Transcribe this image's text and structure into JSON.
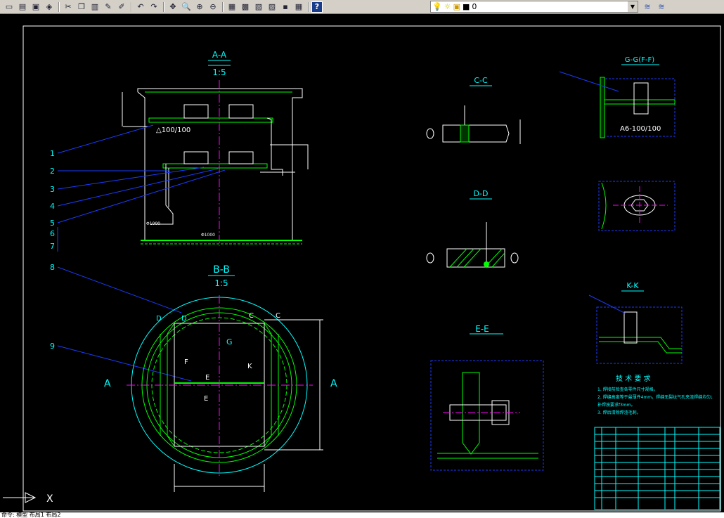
{
  "toolbar": {
    "buttons": [
      {
        "name": "new-icon",
        "glyph": "▭"
      },
      {
        "name": "open-icon",
        "glyph": "▤"
      },
      {
        "name": "save-icon",
        "glyph": "▣"
      },
      {
        "name": "plot-icon",
        "glyph": "◈"
      },
      {
        "sep": true
      },
      {
        "name": "cut-icon",
        "glyph": "✂"
      },
      {
        "name": "copy-icon",
        "glyph": "❐"
      },
      {
        "name": "paste-icon",
        "glyph": "▥"
      },
      {
        "name": "matchprop-icon",
        "glyph": "✎"
      },
      {
        "name": "brush-icon",
        "glyph": "✐"
      },
      {
        "sep": true
      },
      {
        "name": "undo-icon",
        "glyph": "↶"
      },
      {
        "name": "redo-icon",
        "glyph": "↷"
      },
      {
        "sep": true
      },
      {
        "name": "pan-icon",
        "glyph": "✥"
      },
      {
        "name": "zoom-realtime-icon",
        "glyph": "🔍"
      },
      {
        "name": "zoom-window-icon",
        "glyph": "⊕"
      },
      {
        "name": "zoom-previous-icon",
        "glyph": "⊖"
      },
      {
        "sep": true
      },
      {
        "name": "properties-icon",
        "glyph": "▦"
      },
      {
        "name": "designcenter-icon",
        "glyph": "▩"
      },
      {
        "name": "toolpalette-icon",
        "glyph": "▧"
      },
      {
        "name": "sheetset-icon",
        "glyph": "▨"
      },
      {
        "name": "markup-icon",
        "glyph": "▪"
      },
      {
        "name": "calculator-icon",
        "glyph": "▦"
      },
      {
        "sep": true
      }
    ],
    "help_label": "?",
    "layer_name": "0",
    "layer_icons": [
      "bulb-icon",
      "sun-icon",
      "lock-icon",
      "color-square-icon"
    ],
    "layer_state_glyphs": [
      "💡",
      "☼",
      "🔓",
      "■"
    ],
    "right_tools": [
      "≋",
      "≋"
    ]
  },
  "colors": {
    "background": "#000000",
    "white": "#ffffff",
    "cyan": "#00ffff",
    "blue": "#1a3cff",
    "magenta": "#ff00ff",
    "green": "#00ff00",
    "yellow": "#ffff00",
    "red": "#ff0000"
  },
  "drawing": {
    "views": {
      "aa_title": "A-A",
      "aa_scale": "1:5",
      "bb_title": "B-B",
      "bb_scale": "1:5",
      "cc_title": "C-C",
      "dd_title": "D-D",
      "ee_title": "E-E",
      "gg_title": "G-G(F-F)",
      "kk_title": "K-K"
    },
    "weld_note": "△100/100",
    "weld_note_g": "A6-100/100",
    "dim_1000": "Φ1000",
    "callouts": [
      "1",
      "2",
      "3",
      "4",
      "5",
      "6",
      "7",
      "8",
      "9"
    ],
    "section_letters": {
      "a_left": "A",
      "a_right": "A",
      "c1": "C",
      "c2": "C",
      "d1": "D",
      "d2": "D",
      "e1": "E",
      "e2": "E",
      "f": "F",
      "g": "G",
      "k": "K"
    },
    "tech_req_title": "技 术 要 求",
    "tech_req_lines": [
      "1. 焊接前检查各零件尺寸规格。",
      "2. 焊缝高度等于最薄件4mm，焊缝无裂纹气孔夹渣焊缝均匀；",
      "   补焊按要求f3mm。",
      "3. 焊后清除焊渣毛刺。"
    ],
    "ucs_x": "X"
  },
  "command": {
    "text": "命令: 模型  布局1  布局2"
  }
}
